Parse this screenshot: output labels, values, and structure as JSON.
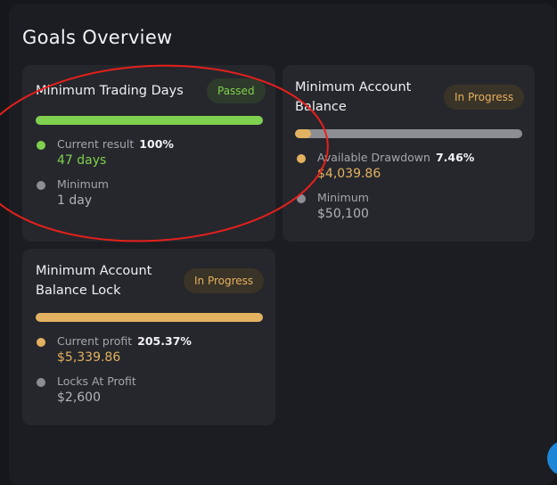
{
  "page": {
    "title": "Goals Overview"
  },
  "colors": {
    "green": "#7fd04f",
    "gold": "#e3b260",
    "track": "#8d8e93",
    "annotation_red": "#e5201c",
    "fab_blue": "#1e86d6"
  },
  "cards": [
    {
      "title": "Minimum Trading Days",
      "badge": "Passed",
      "progress_fraction": 1.0,
      "current_label": "Current result",
      "current_percent": "100%",
      "current_value": "47 days",
      "min_label": "Minimum",
      "min_value": "1 day"
    },
    {
      "title_line1": "Minimum Account",
      "title_line2": "Balance",
      "badge": "In Progress",
      "progress_fraction": 0.07,
      "current_label": "Available Drawdown",
      "current_percent": "7.46%",
      "current_value": "$4,039.86",
      "min_label": "Minimum",
      "min_value": "$50,100"
    },
    {
      "title_line1": "Minimum Account",
      "title_line2": "Balance Lock",
      "badge": "In Progress",
      "progress_fraction": 1.0,
      "current_label": "Current profit",
      "current_percent": "205.37%",
      "current_value": "$5,339.86",
      "min_label": "Locks At Profit",
      "min_value": "$2,600"
    }
  ]
}
